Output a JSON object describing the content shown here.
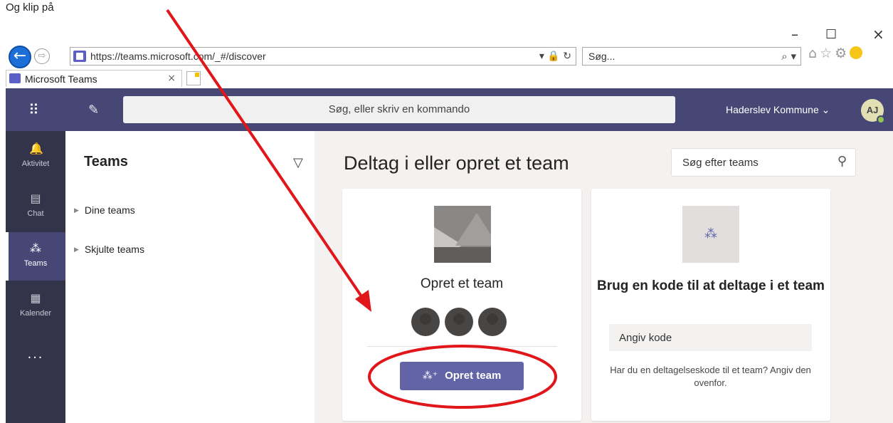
{
  "top_text": "Og klip på",
  "window": {
    "minimize": "–",
    "maximize": "☐",
    "close": "×"
  },
  "browser": {
    "url": "https://teams.microsoft.com/_#/discover",
    "url_tools": "▾ 🔒 ↻",
    "search_placeholder": "Søg...",
    "search_icon": "⌕ ▾",
    "tab_title": "Microsoft Teams",
    "tab_close": "×"
  },
  "header": {
    "command_placeholder": "Søg, eller skriv en kommando",
    "org_name": "Haderslev Kommune ⌄",
    "avatar_initials": "AJ"
  },
  "rail": {
    "items": [
      {
        "label": "Aktivitet",
        "icon": "bell-icon"
      },
      {
        "label": "Chat",
        "icon": "chat-icon"
      },
      {
        "label": "Teams",
        "icon": "teams-icon"
      },
      {
        "label": "Kalender",
        "icon": "calendar-icon"
      }
    ],
    "more": "..."
  },
  "pane": {
    "title": "Teams",
    "groups": [
      "Dine teams",
      "Skjulte teams"
    ]
  },
  "main": {
    "title": "Deltag i eller opret et team",
    "search_placeholder": "Søg efter teams",
    "create_card": {
      "title": "Opret et team",
      "button_label": "Opret team"
    },
    "join_card": {
      "title": "Brug en kode til at deltage i et team",
      "input_placeholder": "Angiv kode",
      "help": "Har du en deltagelseskode til et team? Angiv den ovenfor."
    }
  },
  "colors": {
    "teams_header": "#464775",
    "rail": "#33344a",
    "accent": "#6264a7",
    "annotation": "#e0161b"
  }
}
